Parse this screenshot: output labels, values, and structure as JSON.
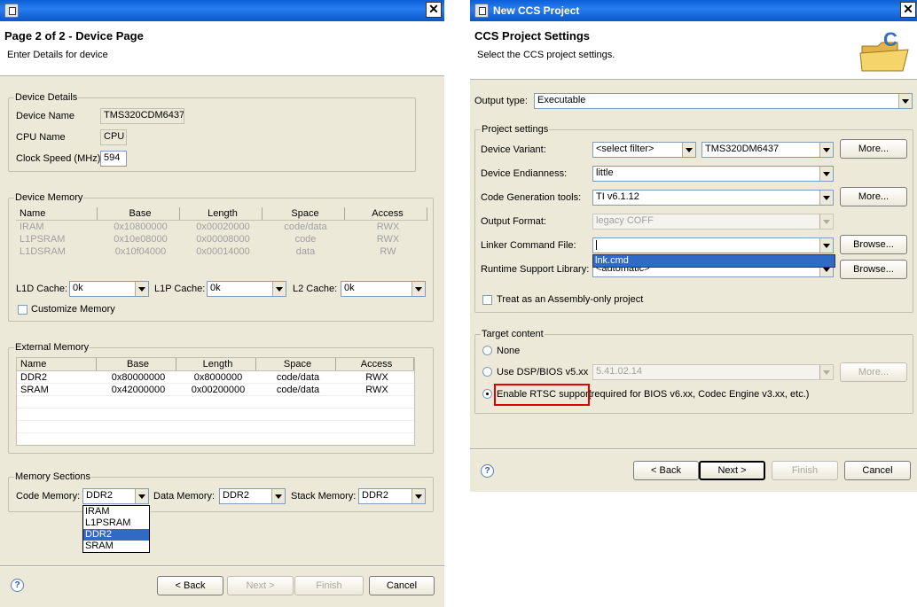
{
  "left_dialog": {
    "title": "",
    "header": {
      "title": "Page 2 of 2 - Device Page",
      "subtitle": "Enter Details for device"
    },
    "device_details": {
      "group_title": "Device Details",
      "device_name_label": "Device Name",
      "device_name_value": "TMS320CDM6437",
      "cpu_name_label": "CPU Name",
      "cpu_name_value": "CPU",
      "clock_speed_label": "Clock Speed (MHz)",
      "clock_speed_value": "594"
    },
    "device_memory": {
      "group_title": "Device Memory",
      "columns": [
        "Name",
        "Base",
        "Length",
        "Space",
        "Access"
      ],
      "rows": [
        [
          "IRAM",
          "0x10800000",
          "0x00020000",
          "code/data",
          "RWX"
        ],
        [
          "L1PSRAM",
          "0x10e08000",
          "0x00008000",
          "code",
          "RWX"
        ],
        [
          "L1DSRAM",
          "0x10f04000",
          "0x00014000",
          "data",
          "RW"
        ]
      ],
      "l1d_label": "L1D Cache:",
      "l1d_value": "0k",
      "l1p_label": "L1P Cache:",
      "l1p_value": "0k",
      "l2_label": "L2 Cache:",
      "l2_value": "0k",
      "customize_label": "Customize Memory"
    },
    "external_memory": {
      "group_title": "External Memory",
      "columns": [
        "Name",
        "Base",
        "Length",
        "Space",
        "Access"
      ],
      "rows": [
        [
          "DDR2",
          "0x80000000",
          "0x8000000",
          "code/data",
          "RWX"
        ],
        [
          "SRAM",
          "0x42000000",
          "0x00200000",
          "code/data",
          "RWX"
        ]
      ]
    },
    "memory_sections": {
      "group_title": "Memory Sections",
      "code_label": "Code Memory:",
      "code_value": "DDR2",
      "data_label": "Data Memory:",
      "data_value": "DDR2",
      "stack_label": "Stack Memory:",
      "stack_value": "DDR2",
      "code_options": [
        "IRAM",
        "L1PSRAM",
        "DDR2",
        "SRAM"
      ],
      "code_selected_index": 2
    },
    "buttons": {
      "back": "< Back",
      "next": "Next >",
      "finish": "Finish",
      "cancel": "Cancel"
    },
    "help_glyph": "?"
  },
  "right_dialog": {
    "title": "New CCS Project",
    "header": {
      "title": "CCS Project Settings",
      "subtitle": "Select the CCS project settings."
    },
    "output_type_label": "Output type:",
    "output_type_value": "Executable",
    "project_settings": {
      "group_title": "Project settings",
      "device_variant_label": "Device Variant:",
      "device_variant_filter": "<select filter>",
      "device_variant_value": "TMS320DM6437",
      "endianness_label": "Device Endianness:",
      "endianness_value": "little",
      "codegen_label": "Code Generation tools:",
      "codegen_value": "TI v6.1.12",
      "output_format_label": "Output Format:",
      "output_format_value": "legacy COFF",
      "linker_label": "Linker Command File:",
      "linker_value": "",
      "linker_suggestion": "lnk.cmd",
      "rts_label": "Runtime Support Library:",
      "rts_value": "<automatic>",
      "more_label": "More...",
      "browse_label": "Browse...",
      "assembly_only_label": "Treat as an Assembly-only project"
    },
    "target_content": {
      "group_title": "Target content",
      "none_label": "None",
      "dspbios_label": "Use DSP/BIOS v5.xx",
      "dspbios_value": "5.41.02.14",
      "more_label": "More...",
      "rtsc_label": "Enable RTSC support",
      "rtsc_note": "(required for BIOS v6.xx, Codec Engine v3.xx, etc.)"
    },
    "buttons": {
      "back": "< Back",
      "next": "Next >",
      "finish": "Finish",
      "cancel": "Cancel"
    },
    "help_glyph": "?",
    "colors": {
      "title_bar": "#0a5fd8",
      "highlight_box": "#e00000",
      "selection": "#316ac5"
    },
    "icons": [
      "app-icon",
      "close-icon",
      "folder-project-icon",
      "help-icon"
    ]
  }
}
